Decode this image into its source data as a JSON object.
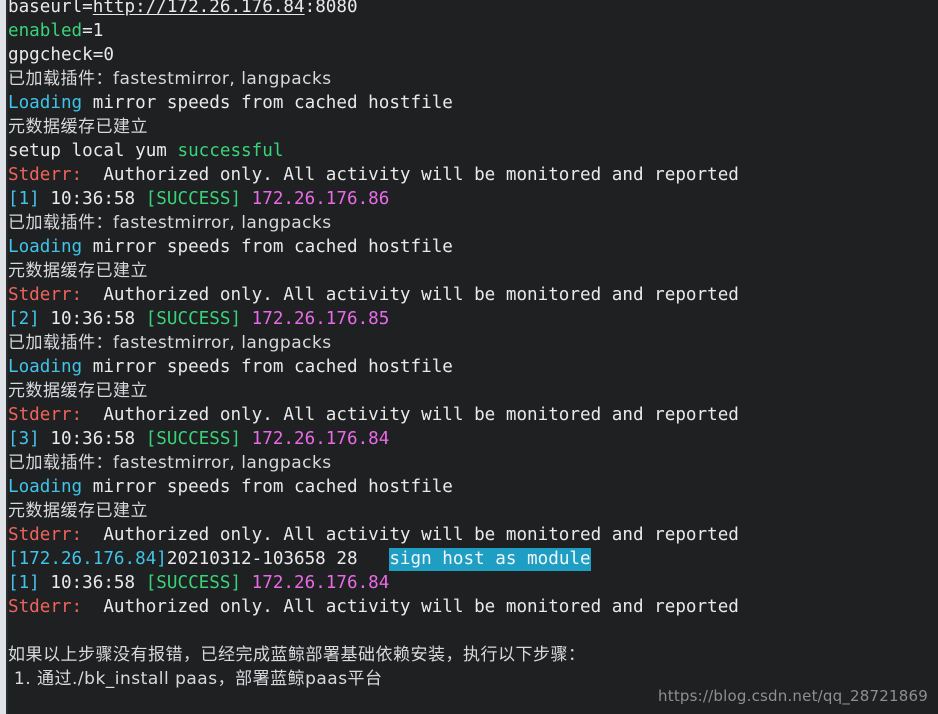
{
  "terminal": {
    "background_color": "#1f2022",
    "gutter_color": "#dfe3e8",
    "palette": {
      "white": "#e9e9e9",
      "green": "#38d47a",
      "cyan": "#3fc3e8",
      "magenta": "#e96ae8",
      "red": "#f0635c",
      "highlight_bg": "#1f9ec4",
      "highlight_fg": "#f2f7f9"
    },
    "lines": [
      {
        "id": "l01",
        "segments": [
          {
            "text": "baseurl=",
            "style": "white"
          },
          {
            "text": "http://172.26.176.84",
            "style": "url"
          },
          {
            "text": ":8080",
            "style": "white"
          }
        ]
      },
      {
        "id": "l02",
        "segments": [
          {
            "text": "enabled",
            "style": "green"
          },
          {
            "text": "=1",
            "style": "white"
          }
        ]
      },
      {
        "id": "l03",
        "segments": [
          {
            "text": "gpgcheck=0",
            "style": "white"
          }
        ]
      },
      {
        "id": "l04",
        "cjk": true,
        "segments": [
          {
            "text": "已加载插件：fastestmirror, langpacks",
            "style": "dim"
          }
        ]
      },
      {
        "id": "l05",
        "segments": [
          {
            "text": "Loading",
            "style": "cyan"
          },
          {
            "text": " mirror speeds from cached hostfile",
            "style": "white"
          }
        ]
      },
      {
        "id": "l06",
        "cjk": true,
        "segments": [
          {
            "text": "元数据缓存已建立",
            "style": "dim"
          }
        ]
      },
      {
        "id": "l07",
        "segments": [
          {
            "text": "setup local yum ",
            "style": "white"
          },
          {
            "text": "successful",
            "style": "green"
          }
        ]
      },
      {
        "id": "l08",
        "segments": [
          {
            "text": "Stderr:",
            "style": "red"
          },
          {
            "text": "  Authorized only. All activity will be monitored and reported",
            "style": "white"
          }
        ]
      },
      {
        "id": "l09",
        "segments": [
          {
            "text": "[1]",
            "style": "cyan"
          },
          {
            "text": " 10:36:58 ",
            "style": "white"
          },
          {
            "text": "[SUCCESS]",
            "style": "green"
          },
          {
            "text": " ",
            "style": "white"
          },
          {
            "text": "172.26.176.86",
            "style": "magenta"
          }
        ]
      },
      {
        "id": "l10",
        "cjk": true,
        "segments": [
          {
            "text": "已加载插件：fastestmirror, langpacks",
            "style": "dim"
          }
        ]
      },
      {
        "id": "l11",
        "segments": [
          {
            "text": "Loading",
            "style": "cyan"
          },
          {
            "text": " mirror speeds from cached hostfile",
            "style": "white"
          }
        ]
      },
      {
        "id": "l12",
        "cjk": true,
        "segments": [
          {
            "text": "元数据缓存已建立",
            "style": "dim"
          }
        ]
      },
      {
        "id": "l13",
        "segments": [
          {
            "text": "Stderr:",
            "style": "red"
          },
          {
            "text": "  Authorized only. All activity will be monitored and reported",
            "style": "white"
          }
        ]
      },
      {
        "id": "l14",
        "segments": [
          {
            "text": "[2]",
            "style": "cyan"
          },
          {
            "text": " 10:36:58 ",
            "style": "white"
          },
          {
            "text": "[SUCCESS]",
            "style": "green"
          },
          {
            "text": " ",
            "style": "white"
          },
          {
            "text": "172.26.176.85",
            "style": "magenta"
          }
        ]
      },
      {
        "id": "l15",
        "cjk": true,
        "segments": [
          {
            "text": "已加载插件：fastestmirror, langpacks",
            "style": "dim"
          }
        ]
      },
      {
        "id": "l16",
        "segments": [
          {
            "text": "Loading",
            "style": "cyan"
          },
          {
            "text": " mirror speeds from cached hostfile",
            "style": "white"
          }
        ]
      },
      {
        "id": "l17",
        "cjk": true,
        "segments": [
          {
            "text": "元数据缓存已建立",
            "style": "dim"
          }
        ]
      },
      {
        "id": "l18",
        "segments": [
          {
            "text": "Stderr:",
            "style": "red"
          },
          {
            "text": "  Authorized only. All activity will be monitored and reported",
            "style": "white"
          }
        ]
      },
      {
        "id": "l19",
        "segments": [
          {
            "text": "[3]",
            "style": "cyan"
          },
          {
            "text": " 10:36:58 ",
            "style": "white"
          },
          {
            "text": "[SUCCESS]",
            "style": "green"
          },
          {
            "text": " ",
            "style": "white"
          },
          {
            "text": "172.26.176.84",
            "style": "magenta"
          }
        ]
      },
      {
        "id": "l20",
        "cjk": true,
        "segments": [
          {
            "text": "已加载插件：fastestmirror, langpacks",
            "style": "dim"
          }
        ]
      },
      {
        "id": "l21",
        "segments": [
          {
            "text": "Loading",
            "style": "cyan"
          },
          {
            "text": " mirror speeds from cached hostfile",
            "style": "white"
          }
        ]
      },
      {
        "id": "l22",
        "cjk": true,
        "segments": [
          {
            "text": "元数据缓存已建立",
            "style": "dim"
          }
        ]
      },
      {
        "id": "l23",
        "segments": [
          {
            "text": "Stderr:",
            "style": "red"
          },
          {
            "text": "  Authorized only. All activity will be monitored and reported",
            "style": "white"
          }
        ]
      },
      {
        "id": "l24",
        "segments": [
          {
            "text": "[172.26.176.84]",
            "style": "cyan"
          },
          {
            "text": "20210312-103658 28   ",
            "style": "white"
          },
          {
            "text": "sign host as module",
            "style": "highlight"
          }
        ]
      },
      {
        "id": "l25",
        "segments": [
          {
            "text": "[1]",
            "style": "cyan"
          },
          {
            "text": " 10:36:58 ",
            "style": "white"
          },
          {
            "text": "[SUCCESS]",
            "style": "green"
          },
          {
            "text": " ",
            "style": "white"
          },
          {
            "text": "172.26.176.84",
            "style": "magenta"
          }
        ]
      },
      {
        "id": "l26",
        "segments": [
          {
            "text": "Stderr:",
            "style": "red"
          },
          {
            "text": "  Authorized only. All activity will be monitored and reported",
            "style": "white"
          }
        ]
      },
      {
        "id": "l27",
        "blank": true,
        "segments": []
      },
      {
        "id": "l28",
        "cjk": true,
        "segments": [
          {
            "text": "如果以上步骤没有报错，已经完成蓝鲸部署基础依赖安装，执行以下步骤：",
            "style": "dim"
          }
        ]
      },
      {
        "id": "l29",
        "cjk": true,
        "segments": [
          {
            "text": " 1. 通过./bk_install paas，部署蓝鲸paas平台",
            "style": "dim"
          }
        ]
      }
    ]
  },
  "watermark": {
    "text": "https://blog.csdn.net/qq_28721869"
  }
}
